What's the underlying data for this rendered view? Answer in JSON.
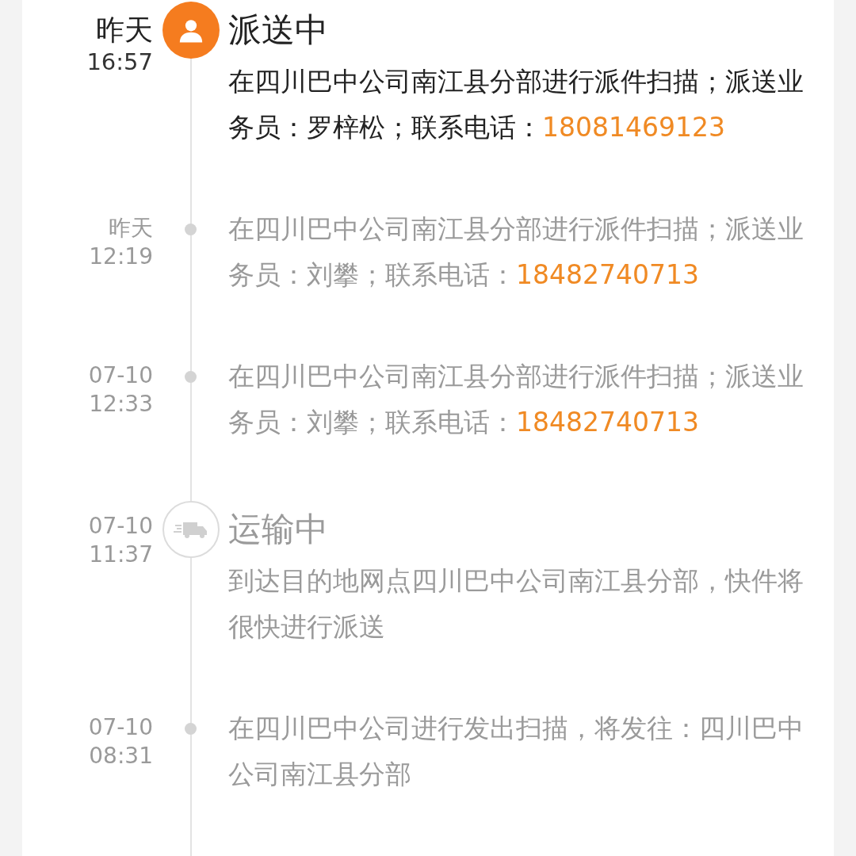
{
  "timeline": [
    {
      "kind": "delivery",
      "active": true,
      "date": "昨天",
      "time": "16:57",
      "status": "派送中",
      "text": "在四川巴中公司南江县分部进行派件扫描；派送业务员：罗梓松；联系电话：",
      "phone": "18081469123"
    },
    {
      "kind": "scan",
      "active": false,
      "date": "昨天",
      "time": "12:19",
      "text": "在四川巴中公司南江县分部进行派件扫描；派送业务员：刘攀；联系电话：",
      "phone": "18482740713"
    },
    {
      "kind": "scan",
      "active": false,
      "date": "07-10",
      "time": "12:33",
      "text": "在四川巴中公司南江县分部进行派件扫描；派送业务员：刘攀；联系电话：",
      "phone": "18482740713"
    },
    {
      "kind": "transit",
      "active": false,
      "date": "07-10",
      "time": "11:37",
      "status": "运输中",
      "text": "到达目的地网点四川巴中公司南江县分部，快件将很快进行派送"
    },
    {
      "kind": "scan",
      "active": false,
      "date": "07-10",
      "time": "08:31",
      "text": "在四川巴中公司进行发出扫描，将发往：四川巴中公司南江县分部"
    }
  ]
}
